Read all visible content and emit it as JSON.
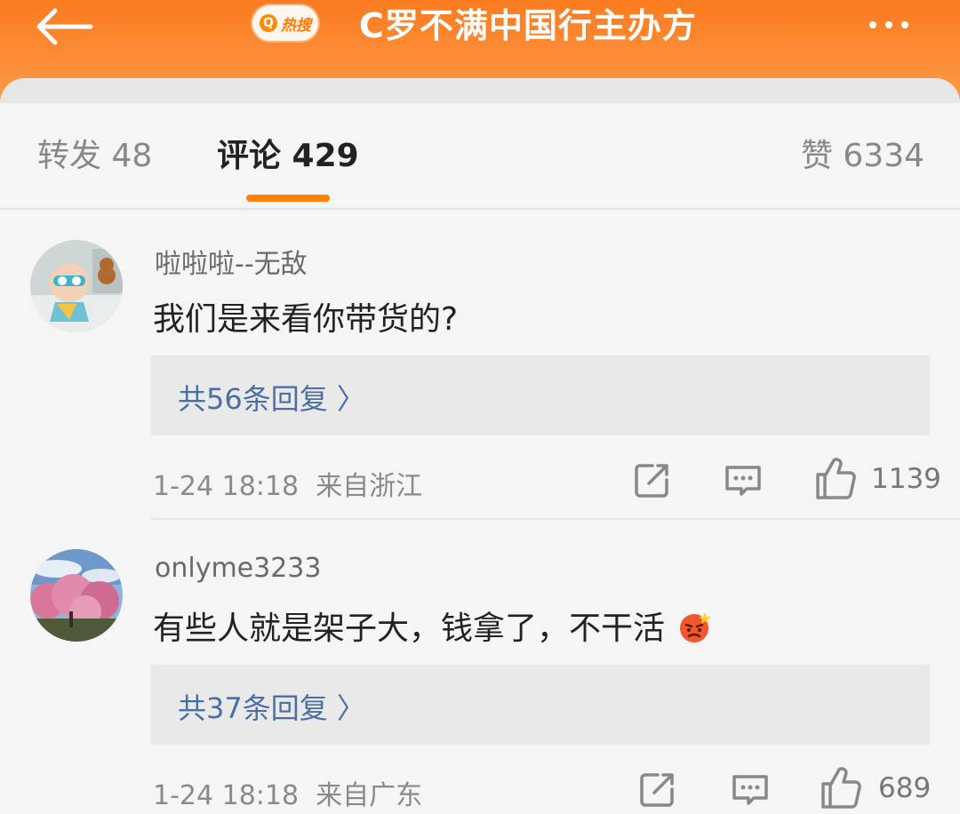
{
  "header": {
    "hot_badge": "热搜",
    "title": "C罗不满中国行主办方"
  },
  "tabs": {
    "forward": "转发 48",
    "comment": "评论 429",
    "like": "赞 6334"
  },
  "comments": [
    {
      "username": "啦啦啦--无敌",
      "text": "我们是来看你带货的?",
      "replies": "共56条回复 〉",
      "time": "1-24 18:18",
      "location": "来自浙江",
      "likes": "1139"
    },
    {
      "username": "onlyme3233",
      "text": "有些人就是架子大，钱拿了，不干活",
      "replies": "共37条回复 〉",
      "time": "1-24 18:18",
      "location": "来自广东",
      "likes": "689"
    }
  ],
  "colors": {
    "accent": "#ff8200",
    "header_gradient_top": "#fb7b1f",
    "link": "#4a6fa5"
  }
}
